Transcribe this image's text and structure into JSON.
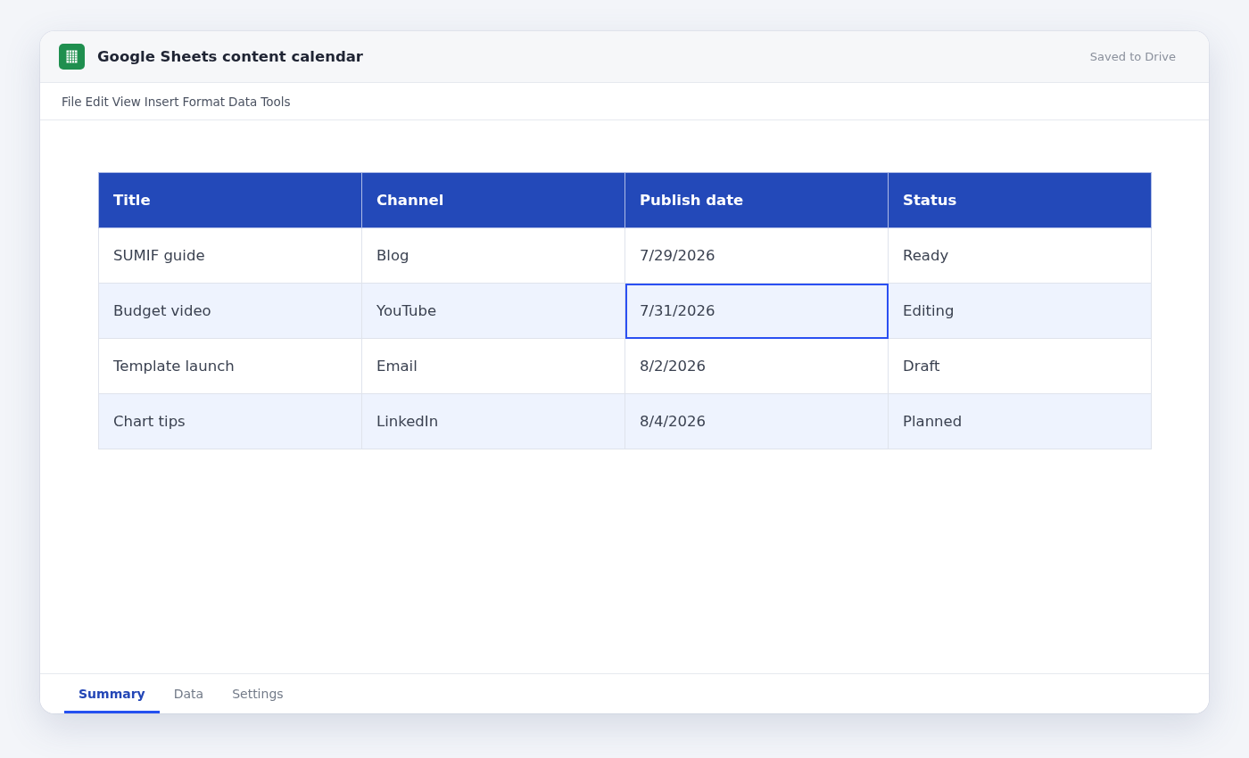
{
  "window": {
    "title": "Google Sheets content calendar",
    "save_status": "Saved to Drive"
  },
  "menu": [
    "File",
    "Edit",
    "View",
    "Insert",
    "Format",
    "Data",
    "Tools"
  ],
  "table": {
    "columns": [
      "Title",
      "Channel",
      "Publish date",
      "Status"
    ],
    "rows": [
      {
        "cells": [
          {
            "text": "SUMIF guide",
            "selected": false
          },
          {
            "text": "Blog",
            "selected": false
          },
          {
            "text": "7/29/2026",
            "selected": false
          },
          {
            "text": "Ready",
            "selected": false
          }
        ]
      },
      {
        "cells": [
          {
            "text": "Budget video",
            "selected": false
          },
          {
            "text": "YouTube",
            "selected": false
          },
          {
            "text": "7/31/2026",
            "selected": true
          },
          {
            "text": "Editing",
            "selected": false
          }
        ]
      },
      {
        "cells": [
          {
            "text": "Template launch",
            "selected": false
          },
          {
            "text": "Email",
            "selected": false
          },
          {
            "text": "8/2/2026",
            "selected": false
          },
          {
            "text": "Draft",
            "selected": false
          }
        ]
      },
      {
        "cells": [
          {
            "text": "Chart tips",
            "selected": false
          },
          {
            "text": "LinkedIn",
            "selected": false
          },
          {
            "text": "8/4/2026",
            "selected": false
          },
          {
            "text": "Planned",
            "selected": false
          }
        ]
      }
    ]
  },
  "sheet_tabs": [
    {
      "label": "Summary",
      "selected": true
    },
    {
      "label": "Data",
      "selected": false
    },
    {
      "label": "Settings",
      "selected": false
    }
  ]
}
